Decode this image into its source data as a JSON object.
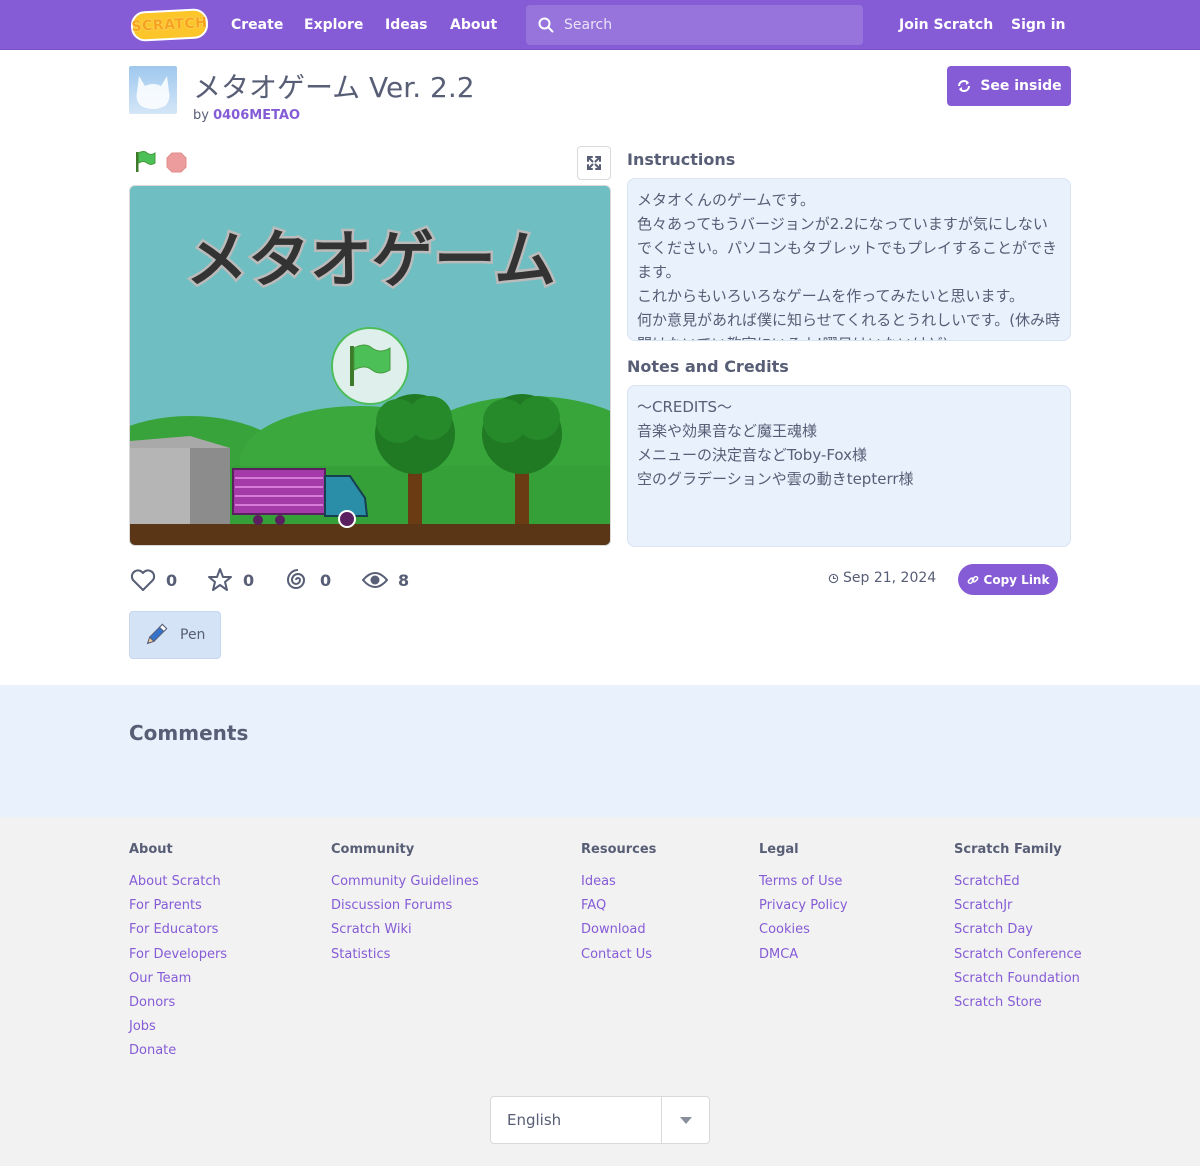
{
  "nav": {
    "logo": "SCRATCH",
    "links": [
      "Create",
      "Explore",
      "Ideas",
      "About"
    ],
    "search_placeholder": "Search",
    "join": "Join Scratch",
    "signin": "Sign in"
  },
  "project": {
    "title": "メタオゲーム Ver. 2.2",
    "by": "by",
    "author": "0406METAO",
    "see_inside": "See inside",
    "stage_title": "メタオゲーム"
  },
  "instructions": {
    "heading": "Instructions",
    "text": "メタオくんのゲームです。\n色々あってもうバージョンが2.2になっていますが気にしないでください。パソコンもタブレットでもプレイすることができます。\nこれからもいろいろなゲームを作ってみたいと思います。\n何か意見があれば僕に知らせてくれるとうれしいです。(休み時間はないでい教室にいるよ!曜日はいないけど)"
  },
  "notes": {
    "heading": "Notes and Credits",
    "text": "〜CREDITS〜\n音楽や効果音など魔王魂様\nメニューの決定音などToby-Fox様\n空のグラデーションや雲の動きtepterr様"
  },
  "stats": {
    "loves": "0",
    "favorites": "0",
    "remixes": "0",
    "views": "8",
    "date": "Sep 21, 2024",
    "copy_link": "Copy Link"
  },
  "extensions": {
    "pen": "Pen"
  },
  "comments": {
    "heading": "Comments"
  },
  "footer": {
    "columns": [
      {
        "title": "About",
        "links": [
          "About Scratch",
          "For Parents",
          "For Educators",
          "For Developers",
          "Our Team",
          "Donors",
          "Jobs",
          "Donate"
        ]
      },
      {
        "title": "Community",
        "links": [
          "Community Guidelines",
          "Discussion Forums",
          "Scratch Wiki",
          "Statistics"
        ]
      },
      {
        "title": "Resources",
        "links": [
          "Ideas",
          "FAQ",
          "Download",
          "Contact Us"
        ]
      },
      {
        "title": "Legal",
        "links": [
          "Terms of Use",
          "Privacy Policy",
          "Cookies",
          "DMCA"
        ]
      },
      {
        "title": "Scratch Family",
        "links": [
          "ScratchEd",
          "ScratchJr",
          "Scratch Day",
          "Scratch Conference",
          "Scratch Foundation",
          "Scratch Store"
        ]
      }
    ],
    "language": "English"
  },
  "colors": {
    "brand": "#855cd6",
    "text": "#575e75",
    "comments_bg": "#e9f1fc",
    "footer_bg": "#f2f2f2"
  }
}
